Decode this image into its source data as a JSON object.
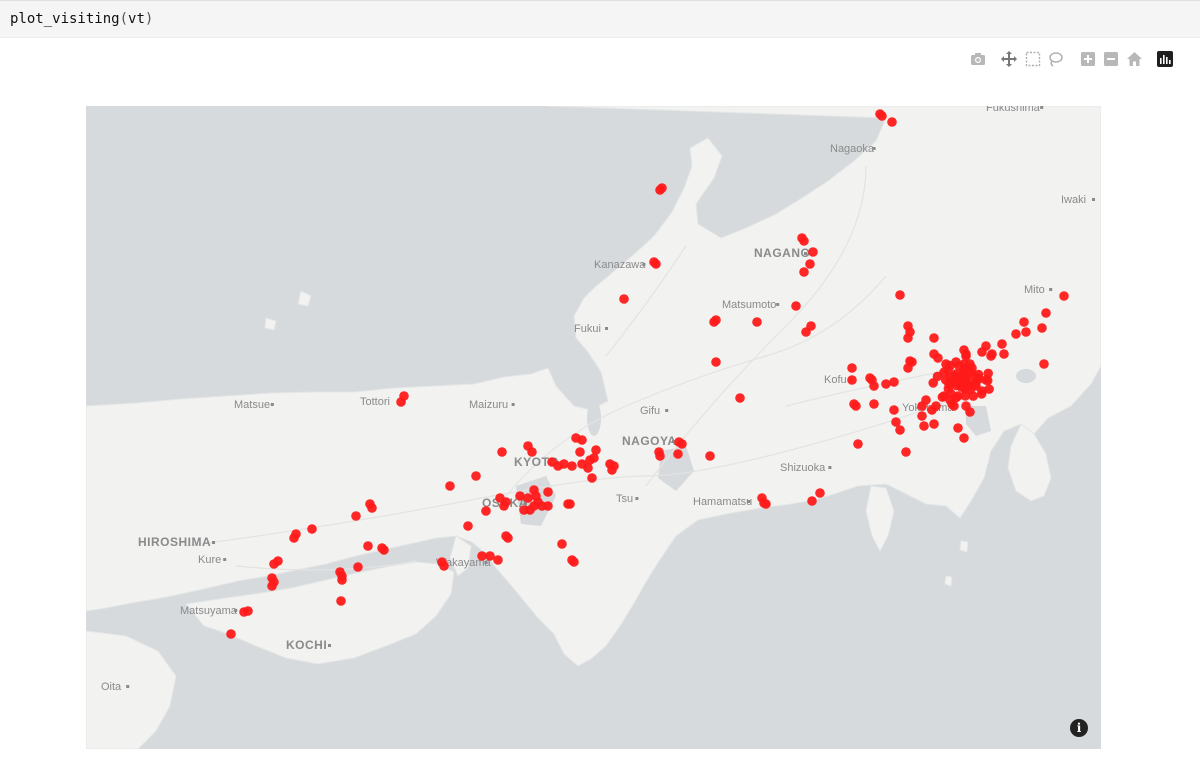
{
  "cell": {
    "code": "plot_visiting",
    "arg": "vt"
  },
  "modebar": {
    "buttons": [
      {
        "name": "camera-icon"
      },
      {
        "name": "pan-icon"
      },
      {
        "name": "box-select-icon"
      },
      {
        "name": "lasso-icon"
      },
      {
        "name": "zoom-in-icon"
      },
      {
        "name": "zoom-out-icon"
      },
      {
        "name": "home-icon"
      },
      {
        "name": "plotly-logo-icon"
      }
    ]
  },
  "map": {
    "land_color": "#f2f2f1",
    "water_color": "#d6dadc",
    "marker_color": "#ff1a1a",
    "cities": [
      {
        "id": "fukushima",
        "label": "Fukushima"
      },
      {
        "id": "nagaoka",
        "label": "Nagaoka"
      },
      {
        "id": "iwaki",
        "label": "Iwaki"
      },
      {
        "id": "nagano",
        "label": "NAGANO"
      },
      {
        "id": "kanazawa",
        "label": "Kanazawa"
      },
      {
        "id": "mito",
        "label": "Mito"
      },
      {
        "id": "matsumoto",
        "label": "Matsumoto"
      },
      {
        "id": "fukui",
        "label": "Fukui"
      },
      {
        "id": "kofu",
        "label": "Kofu"
      },
      {
        "id": "matsue",
        "label": "Matsue"
      },
      {
        "id": "tottori",
        "label": "Tottori"
      },
      {
        "id": "maizuru",
        "label": "Maizuru"
      },
      {
        "id": "gifu",
        "label": "Gifu"
      },
      {
        "id": "yokohama",
        "label": "Yokohama"
      },
      {
        "id": "nagoya",
        "label": "NAGOYA"
      },
      {
        "id": "kyoto",
        "label": "KYOTO"
      },
      {
        "id": "shizuoka",
        "label": "Shizuoka"
      },
      {
        "id": "osaka",
        "label": "OSAKA"
      },
      {
        "id": "tsu",
        "label": "Tsu"
      },
      {
        "id": "hamamatsu",
        "label": "Hamamatsu"
      },
      {
        "id": "hiroshima",
        "label": "HIROSHIMA"
      },
      {
        "id": "kure",
        "label": "Kure"
      },
      {
        "id": "wakayama",
        "label": "Wakayama"
      },
      {
        "id": "matsuyama",
        "label": "Matsuyama"
      },
      {
        "id": "kochi",
        "label": "KOCHI"
      },
      {
        "id": "oita",
        "label": "Oita"
      }
    ],
    "info_label": "i"
  }
}
